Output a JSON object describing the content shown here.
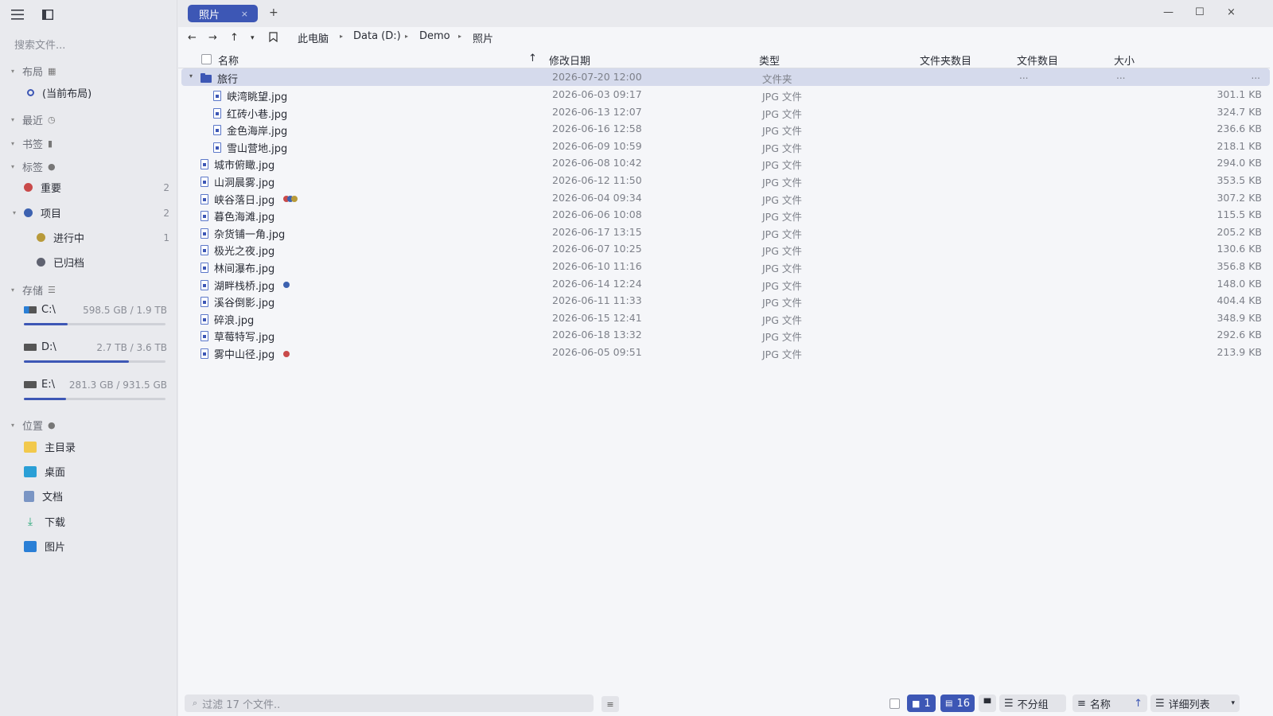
{
  "sidebar": {
    "search_placeholder": "搜索文件...",
    "layout": {
      "label": "布局",
      "current": "(当前布局)"
    },
    "recent": {
      "label": "最近"
    },
    "bookmarks": {
      "label": "书签"
    },
    "tags": {
      "label": "标签",
      "items": [
        {
          "label": "重要",
          "count": "2",
          "color": "#c94a4a"
        },
        {
          "label": "项目",
          "count": "2",
          "color": "#3d62b0"
        },
        {
          "label": "进行中",
          "count": "1",
          "color": "#b89a3a"
        },
        {
          "label": "已归档",
          "count": "",
          "color": "#5f6270"
        }
      ]
    },
    "storage": {
      "label": "存储",
      "drives": [
        {
          "name": "C:\\",
          "size": "598.5 GB / 1.9 TB",
          "used_fraction": 0.31
        },
        {
          "name": "D:\\",
          "size": "2.7 TB / 3.6 TB",
          "used_fraction": 0.74
        },
        {
          "name": "E:\\",
          "size": "281.3 GB / 931.5 GB",
          "used_fraction": 0.3
        }
      ]
    },
    "places": {
      "label": "位置",
      "items": [
        {
          "label": "主目录",
          "icon": "folder-icon",
          "color": "#f2c94c"
        },
        {
          "label": "桌面",
          "icon": "desktop-icon",
          "color": "#2a9fd6"
        },
        {
          "label": "文档",
          "icon": "document-icon",
          "color": "#7a95c4"
        },
        {
          "label": "下载",
          "icon": "download-icon",
          "color": "#2aa878"
        },
        {
          "label": "图片",
          "icon": "picture-icon",
          "color": "#2a7fd6"
        }
      ]
    }
  },
  "titlebar": {
    "tab_label": "照片",
    "tab_close": "×",
    "new_tab": "+",
    "minimize": "—",
    "maximize": "☐",
    "close": "×"
  },
  "breadcrumb": [
    "此电脑",
    "Data (D:)",
    "Demo",
    "照片"
  ],
  "columns": {
    "name": "名称",
    "sort_arrow": "↑",
    "modified": "修改日期",
    "type": "类型",
    "folder_count": "文件夹数目",
    "file_count": "文件数目",
    "size": "大小"
  },
  "folder_row": {
    "name": "旅行",
    "date": "2026-07-20 12:00",
    "type": "文件夹",
    "dots": "..."
  },
  "files": [
    {
      "name": "峡湾眺望.jpg",
      "date": "2026-06-03 09:17",
      "type": "JPG 文件",
      "size": "301.1 KB",
      "child": true
    },
    {
      "name": "红砖小巷.jpg",
      "date": "2026-06-13 12:07",
      "type": "JPG 文件",
      "size": "324.7 KB",
      "child": true
    },
    {
      "name": "金色海岸.jpg",
      "date": "2026-06-16 12:58",
      "type": "JPG 文件",
      "size": "236.6 KB",
      "child": true
    },
    {
      "name": "雪山营地.jpg",
      "date": "2026-06-09 10:59",
      "type": "JPG 文件",
      "size": "218.1 KB",
      "child": true
    },
    {
      "name": "城市俯瞰.jpg",
      "date": "2026-06-08 10:42",
      "type": "JPG 文件",
      "size": "294.0 KB",
      "child": false
    },
    {
      "name": "山洞晨雾.jpg",
      "date": "2026-06-12 11:50",
      "type": "JPG 文件",
      "size": "353.5 KB",
      "child": false
    },
    {
      "name": "峡谷落日.jpg",
      "date": "2026-06-04 09:34",
      "type": "JPG 文件",
      "size": "307.2 KB",
      "child": false,
      "tags": [
        "#c94a4a",
        "#3d62b0",
        "#b89a3a"
      ]
    },
    {
      "name": "暮色海滩.jpg",
      "date": "2026-06-06 10:08",
      "type": "JPG 文件",
      "size": "115.5 KB",
      "child": false
    },
    {
      "name": "杂货铺一角.jpg",
      "date": "2026-06-17 13:15",
      "type": "JPG 文件",
      "size": "205.2 KB",
      "child": false
    },
    {
      "name": "极光之夜.jpg",
      "date": "2026-06-07 10:25",
      "type": "JPG 文件",
      "size": "130.6 KB",
      "child": false
    },
    {
      "name": "林间瀑布.jpg",
      "date": "2026-06-10 11:16",
      "type": "JPG 文件",
      "size": "356.8 KB",
      "child": false
    },
    {
      "name": "湖畔栈桥.jpg",
      "date": "2026-06-14 12:24",
      "type": "JPG 文件",
      "size": "148.0 KB",
      "child": false,
      "tags": [
        "#3d62b0"
      ]
    },
    {
      "name": "溪谷倒影.jpg",
      "date": "2026-06-11 11:33",
      "type": "JPG 文件",
      "size": "404.4 KB",
      "child": false
    },
    {
      "name": "碎浪.jpg",
      "date": "2026-06-15 12:41",
      "type": "JPG 文件",
      "size": "348.9 KB",
      "child": false
    },
    {
      "name": "草莓特写.jpg",
      "date": "2026-06-18 13:32",
      "type": "JPG 文件",
      "size": "292.6 KB",
      "child": false
    },
    {
      "name": "雾中山径.jpg",
      "date": "2026-06-05 09:51",
      "type": "JPG 文件",
      "size": "213.9 KB",
      "child": false,
      "tags": [
        "#c94a4a"
      ]
    }
  ],
  "bottombar": {
    "filter_placeholder": "过滤 17 个文件..",
    "folders_count": "1",
    "files_count": "16",
    "group_label": "不分组",
    "sort_label": "名称",
    "sort_arrow": "↑",
    "view_label": "详细列表",
    "view_arrow": "▾"
  },
  "colors": {
    "accent": "#3d57b5",
    "selection": "#d5daec"
  }
}
